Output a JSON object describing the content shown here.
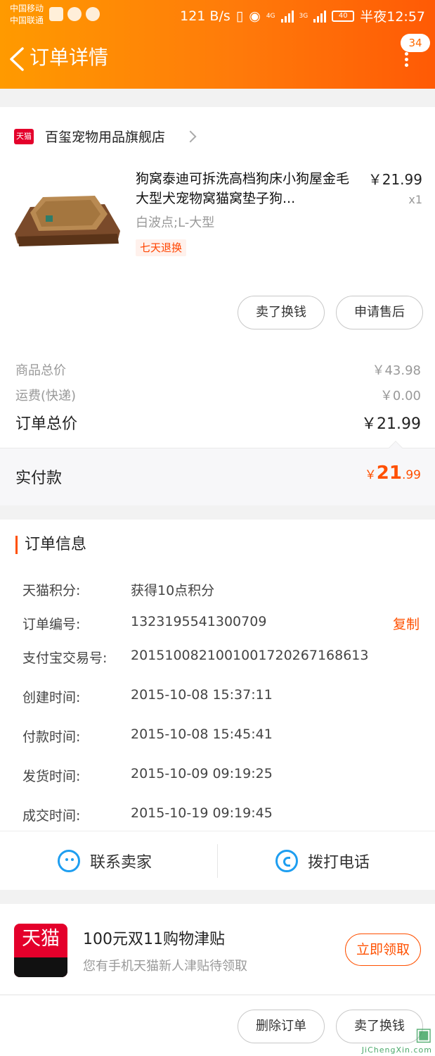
{
  "status_bar": {
    "carrier_1": "中国移动",
    "carrier_2": "中国联通",
    "speed": "121 B/s",
    "network_4g": "4G",
    "network_3g": "3G",
    "battery": "40",
    "time": "半夜12:57"
  },
  "nav": {
    "title": "订单详情",
    "badge_count": "34"
  },
  "shop": {
    "platform_label": "天猫",
    "name": "百玺宠物用品旗舰店"
  },
  "product": {
    "title": "狗窝泰迪可拆洗高档狗床小狗屋金毛大型犬宠物窝猫窝垫子狗...",
    "price": "￥21.99",
    "quantity": "x1",
    "sku": "白波点;L-大型",
    "tag": "七天退换"
  },
  "item_actions": {
    "sell": "卖了换钱",
    "after_sale": "申请售后"
  },
  "prices": {
    "goods_total_label": "商品总价",
    "goods_total_value": "￥43.98",
    "shipping_label": "运费(快递)",
    "shipping_value": "￥0.00",
    "order_total_label": "订单总价",
    "order_total_value": "￥21.99",
    "paid_label": "实付款",
    "paid_currency": "￥",
    "paid_int": "21",
    "paid_dec": ".99"
  },
  "order_info": {
    "section_title": "订单信息",
    "copy_label": "复制",
    "rows": [
      {
        "label": "天猫积分:",
        "value": "获得10点积分"
      },
      {
        "label": "订单编号:",
        "value": "1323195541300709"
      },
      {
        "label": "支付宝交易号:",
        "value": "2015100821001001720267168613"
      },
      {
        "label": "创建时间:",
        "value": "2015-10-08 15:37:11"
      },
      {
        "label": "付款时间:",
        "value": "2015-10-08 15:45:41"
      },
      {
        "label": "发货时间:",
        "value": "2015-10-09 09:19:25"
      },
      {
        "label": "成交时间:",
        "value": "2015-10-19 09:19:45"
      }
    ]
  },
  "contact": {
    "seller": "联系卖家",
    "call": "拨打电话"
  },
  "promo": {
    "logo_text": "天猫",
    "title": "100元双11购物津贴",
    "subtitle": "您有手机天猫新人津贴待领取",
    "claim": "立即领取"
  },
  "bottom_actions": {
    "delete": "删除订单",
    "sell": "卖了换钱"
  },
  "watermark": {
    "line1": "JiChengXin.com"
  },
  "colors": {
    "accent": "#ff5000",
    "header_start": "#ff9a00",
    "header_end": "#ff5a05",
    "tmall_red": "#e4002b",
    "link_blue": "#1e9ef0"
  }
}
